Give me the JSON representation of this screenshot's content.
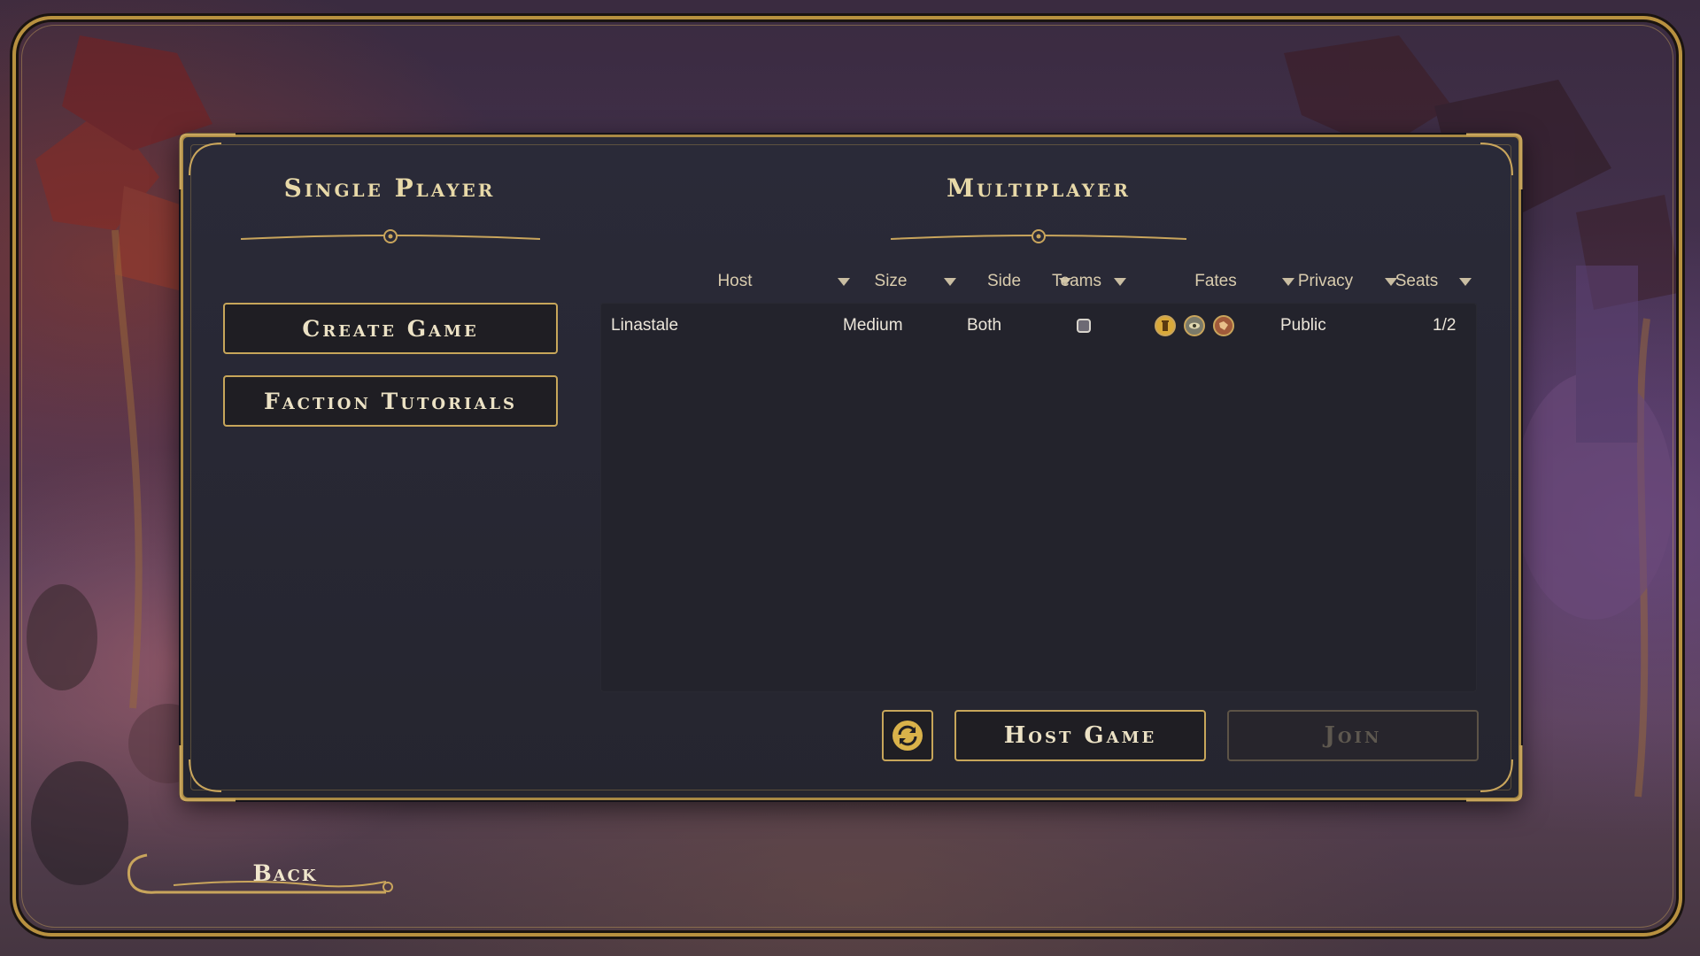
{
  "single_player": {
    "title": "Single Player",
    "buttons": [
      {
        "label": "Create Game"
      },
      {
        "label": "Faction Tutorials"
      }
    ]
  },
  "multiplayer": {
    "title": "Multiplayer",
    "columns": [
      {
        "label": "Host",
        "sortable": true
      },
      {
        "label": "Size",
        "sortable": true
      },
      {
        "label": "Side",
        "sortable": true
      },
      {
        "label": "Teams",
        "sortable": true
      },
      {
        "label": "Fates",
        "sortable": true
      },
      {
        "label": "Privacy",
        "sortable": true
      },
      {
        "label": "Seats",
        "sortable": true
      }
    ],
    "games": [
      {
        "host": "Linastale",
        "size": "Medium",
        "side": "Both",
        "teams": false,
        "fates": [
          "tower-fate-icon",
          "eye-fate-icon",
          "crest-fate-icon"
        ],
        "privacy": "Public",
        "seats": "1/2"
      }
    ],
    "actions": {
      "refresh_icon": "refresh-icon",
      "host_label": "Host Game",
      "join_label": "Join",
      "join_enabled": false
    }
  },
  "back_label": "Back",
  "colors": {
    "gold": "#c7a65a",
    "panel": "#2a2a38",
    "text": "#ece6da"
  }
}
